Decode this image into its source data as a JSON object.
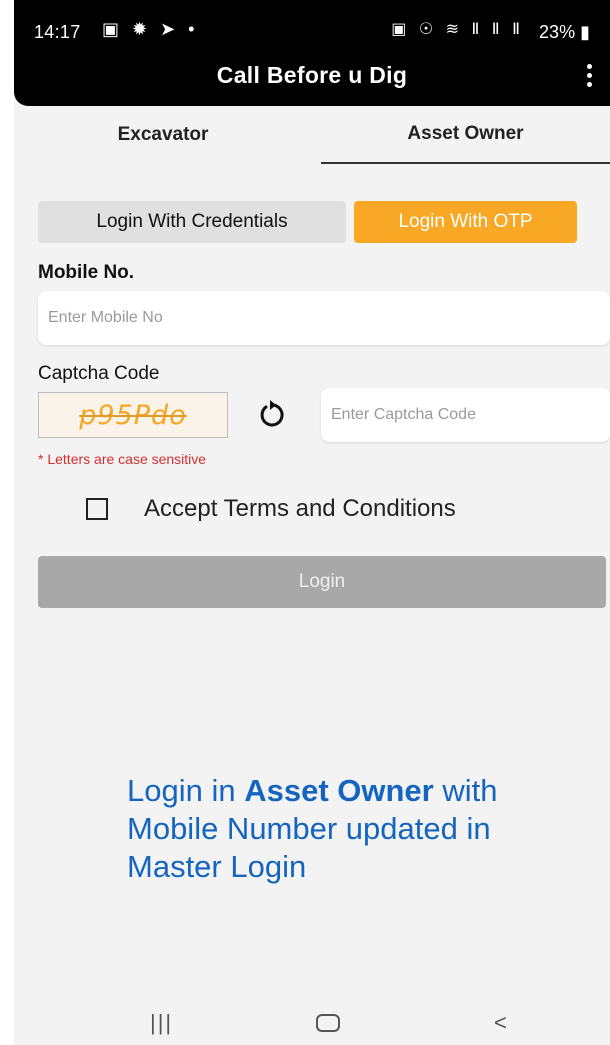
{
  "status_bar": {
    "time": "14:17",
    "left_icons": "▣ ✹ ➤ •",
    "right_icons": "▣ ☉ ≋ Ⅱ Ⅱ Ⅱ",
    "battery": "23%"
  },
  "app_bar": {
    "title": "Call Before u Dig"
  },
  "tabs": [
    {
      "label": "Excavator"
    },
    {
      "label": "Asset Owner",
      "selected": true
    }
  ],
  "login_modes": {
    "credentials": "Login With Credentials",
    "otp": "Login With OTP",
    "active": "otp"
  },
  "mobile": {
    "label": "Mobile No.",
    "placeholder": "Enter Mobile No",
    "value": ""
  },
  "captcha": {
    "label": "Captcha Code",
    "code": "p95Pdo",
    "placeholder": "Enter Captcha Code",
    "note": "* Letters are case sensitive"
  },
  "terms": {
    "label": "Accept Terms and Conditions",
    "checked": false
  },
  "login_button": {
    "label": "Login"
  },
  "caption": {
    "prefix": "Login in ",
    "highlight": "Asset Owner",
    "suffix": " with Mobile Number updated in Master Login"
  },
  "nav_bar": {
    "recent": "|||",
    "back": "<"
  },
  "colors": {
    "accent_orange": "#f9a825",
    "caption_blue": "#1565c0",
    "error_red": "#d32f2f",
    "disabled_grey": "#a8a8a8"
  }
}
